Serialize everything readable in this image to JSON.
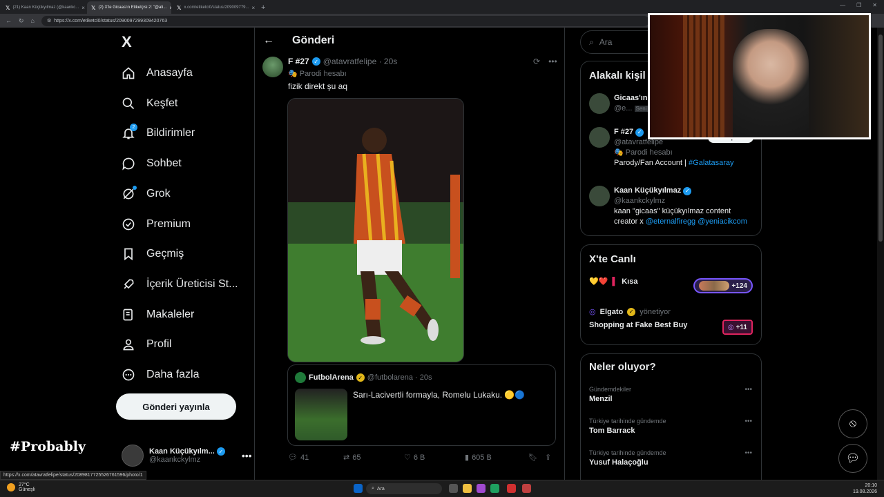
{
  "browser": {
    "tabs": [
      {
        "label": "(21) Kaan Küçükyılmaz (@kaankc...",
        "active": false
      },
      {
        "label": "(2) X'te Gicaas'ın Etiketçisi 2: \"@ati...",
        "active": true
      },
      {
        "label": "x.com/etiketci0/status/209009779...",
        "active": false
      }
    ],
    "url": "https://x.com/etiketci0/status/2090097299309420763",
    "status_url": "https://x.com/atavratfelipe/status/2089817725526761596/photo/1"
  },
  "nav": {
    "logo": "X",
    "items": [
      {
        "label": "Anasayfa",
        "icon": "home-icon"
      },
      {
        "label": "Keşfet",
        "icon": "search-icon"
      },
      {
        "label": "Bildirimler",
        "icon": "bell-icon",
        "badge": "2"
      },
      {
        "label": "Sohbet",
        "icon": "chat-icon"
      },
      {
        "label": "Grok",
        "icon": "grok-icon"
      },
      {
        "label": "Premium",
        "icon": "premium-icon"
      },
      {
        "label": "Geçmiş",
        "icon": "bookmark-icon"
      },
      {
        "label": "İçerik Üreticisi St...",
        "icon": "rocket-icon"
      },
      {
        "label": "Makaleler",
        "icon": "article-icon"
      },
      {
        "label": "Profil",
        "icon": "profile-icon"
      },
      {
        "label": "Daha fazla",
        "icon": "more-icon"
      }
    ],
    "post_button": "Gönderi yayınla",
    "account": {
      "name": "Kaan Küçükyılm...",
      "handle": "@kaankckylmz"
    }
  },
  "overlay_text": "#Probably",
  "main": {
    "header": "Gönderi",
    "tweet": {
      "name": "F #27",
      "handle": "@atavratfelipe · 20s",
      "parody": "Parodi hesabı",
      "text": "fizik direkt şu aq",
      "quote": {
        "name": "FutbolArena",
        "handle": "@futbolarena · 20s",
        "text": "Sarı-Lacivertli formayla, Romelu Lukaku. 🟡🔵"
      },
      "actions": {
        "replies": "41",
        "reposts": "65",
        "likes": "6 B",
        "views": "605 B"
      }
    }
  },
  "right": {
    "search_placeholder": "Ara",
    "related": {
      "title": "Alakalı kişil",
      "people": [
        {
          "name": "Gicaas'ın",
          "handle": "@e...",
          "tag": "Seni"
        },
        {
          "name": "F #27",
          "handle": "@atavratfelipe",
          "line2": "Parodi hesabı",
          "bio": "Parody/Fan Account |",
          "link": "#Galatasaray",
          "follow": "Takip et"
        },
        {
          "name": "Kaan Küçükyılmaz",
          "handle": "@kaankckylmz",
          "bio": "kaan \"gicaas\" küçükyılmaz content creator x",
          "link": "@eternalfiregg @yeniacikcom"
        }
      ]
    },
    "live": {
      "title": "X'te Canlı",
      "items": [
        {
          "label": "Kısa",
          "emoji": "💛❤️",
          "count": "+124"
        },
        {
          "host": "Elgato",
          "role": "yönetiyor",
          "label": "Shopping at Fake Best Buy",
          "count": "+11"
        }
      ]
    },
    "trends": {
      "title": "Neler oluyor?",
      "items": [
        {
          "category": "Gündemdekiler",
          "topic": "Menzil"
        },
        {
          "category": "Türkiye tarihinde gündemde",
          "topic": "Tom Barrack"
        },
        {
          "category": "Türkiye tarihinde gündemde",
          "topic": "Yusuf Halaçoğlu"
        }
      ]
    }
  },
  "taskbar": {
    "temp": "27°C",
    "weather": "Güneşli",
    "search": "Ara",
    "time": "20:10",
    "date": "19.08.2026"
  }
}
